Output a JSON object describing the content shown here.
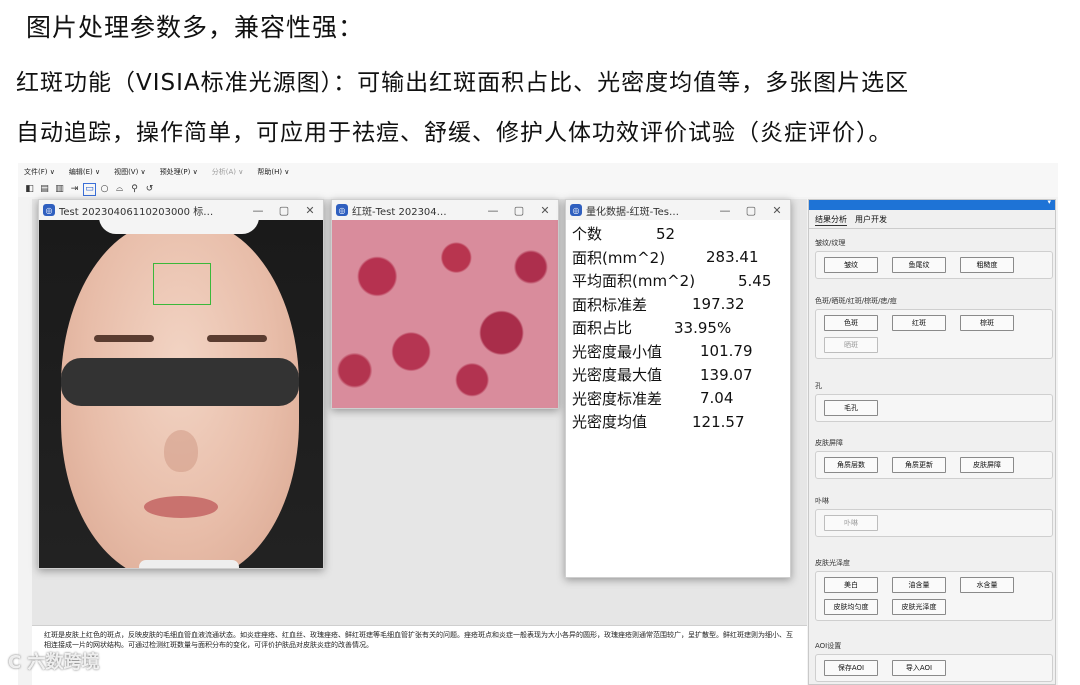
{
  "headline": "图片处理参数多，兼容性强：",
  "paragraph_line1": "红斑功能（VISIA标准光源图）：可输出红斑面积占比、光密度均值等，多张图片选区",
  "paragraph_line2": "自动追踪，操作简单，可应用于祛痘、舒缓、修护人体功效评价试验（炎症评价）。",
  "menu": {
    "file": "文件(F) ∨",
    "edit": "编辑(E) ∨",
    "view": "视图(V) ∨",
    "preprocess": "预处理(P) ∨",
    "analysis": "分析(A) ∨",
    "help": "帮助(H) ∨"
  },
  "windows": {
    "face": {
      "title": "Test 20230406110203000 标…"
    },
    "redmap": {
      "title": "红斑-Test 202304…"
    },
    "data": {
      "title": "量化数据-红斑-Tes…",
      "rows": [
        {
          "k": "个数",
          "v": "52"
        },
        {
          "k": "面积(mm^2)",
          "v": "283.41"
        },
        {
          "k": "平均面积(mm^2)",
          "v": "5.45"
        },
        {
          "k": "面积标准差",
          "v": "197.32"
        },
        {
          "k": "面积占比",
          "v": "33.95%"
        },
        {
          "k": "光密度最小值",
          "v": "101.79"
        },
        {
          "k": "光密度最大值",
          "v": "139.07"
        },
        {
          "k": "光密度标准差",
          "v": "7.04"
        },
        {
          "k": "光密度均值",
          "v": "121.57"
        }
      ]
    }
  },
  "panel": {
    "tabs": [
      "结果分析",
      "用户开发"
    ],
    "groups": [
      {
        "label": "皱纹/纹理",
        "buttons": [
          "皱纹",
          "鱼尾纹",
          "粗糙度"
        ],
        "disabled": []
      },
      {
        "label": "色斑/晒斑/红斑/棕斑/痣/痘",
        "buttons": [
          "色斑",
          "红斑",
          "棕斑",
          "晒斑"
        ],
        "disabled": [
          "晒斑"
        ]
      },
      {
        "label": "孔",
        "buttons": [
          "毛孔"
        ],
        "disabled": []
      },
      {
        "label": "皮肤屏障",
        "buttons": [
          "角质层数",
          "角质更新",
          "皮肤屏障"
        ],
        "disabled": []
      },
      {
        "label": "卟啉",
        "buttons": [
          "卟啉"
        ],
        "disabled": [
          "卟啉"
        ]
      },
      {
        "label": "皮肤光泽度",
        "buttons": [
          "美白",
          "油含量",
          "水含量",
          "皮肤均匀度",
          "皮肤光泽度"
        ],
        "disabled": []
      },
      {
        "label": "AOI设置",
        "buttons": [
          "保存AOI",
          "导入AOI"
        ],
        "disabled": []
      }
    ]
  },
  "description": "红斑是皮肤上红色的斑点，反映皮肤的毛细血管血液流通状态。如炎症痤疮、红血丝、玫瑰痤疮、鲜红斑痣等毛细血管扩张有关的问题。痤疮斑点和炎症一般表现为大小各异的圆形，玫瑰痤疮则通常范围较广，呈扩散型。鲜红斑痣则为细小、互相连接成一片的网状结构。可通过检测红斑数量与面积分布的变化，可评价护肤品对皮肤炎症的改善情况。",
  "watermark": "C 六数跨境",
  "colors": {
    "accent": "#1e73d6",
    "roi": "#3ab83a",
    "redmap": "#b23350"
  }
}
